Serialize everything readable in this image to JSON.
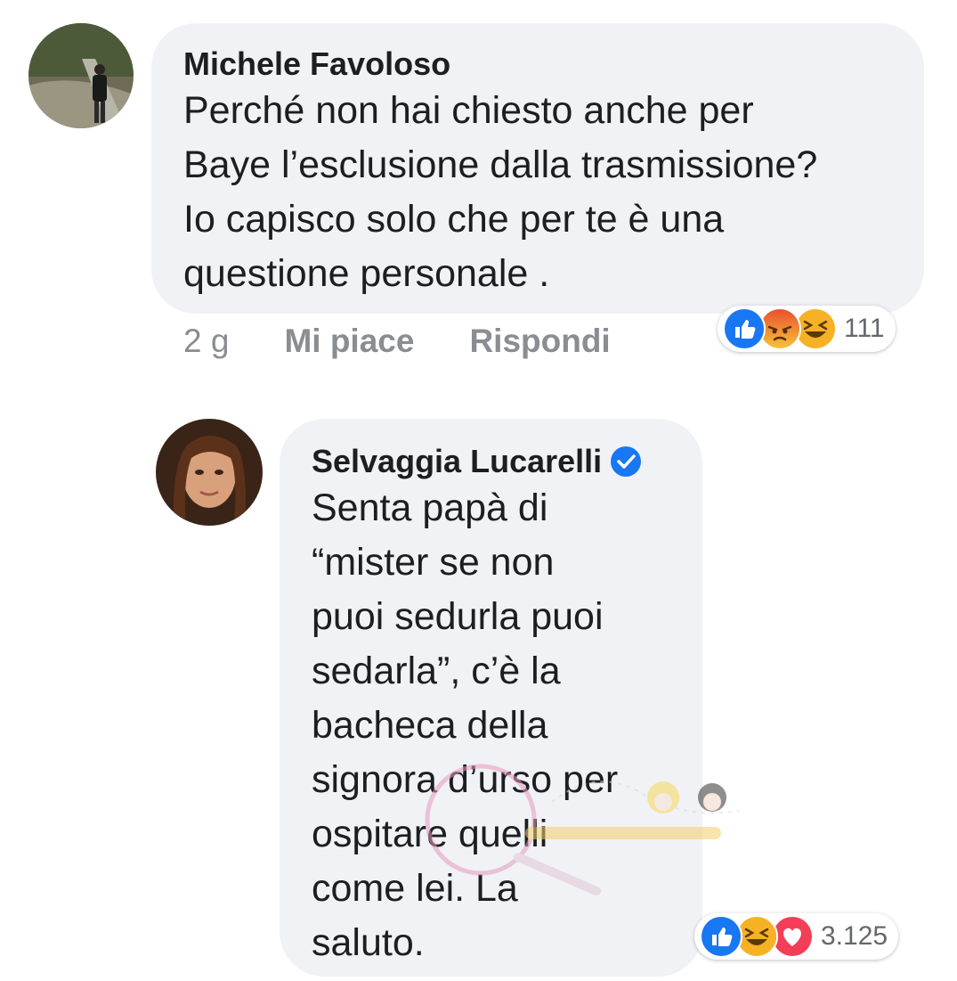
{
  "comment1": {
    "author": "Michele Favoloso",
    "lines": [
      "Perché non hai chiesto anche per",
      "Baye l’esclusione dalla trasmissione?",
      "Io capisco solo che per te è una",
      "questione personale ."
    ],
    "time": "2 g",
    "like_label": "Mi piace",
    "reply_label": "Rispondi",
    "reactions": [
      "like-icon",
      "angry-icon",
      "haha-icon"
    ],
    "reaction_count": "111"
  },
  "comment2": {
    "author": "Selvaggia Lucarelli",
    "verified": true,
    "lines": [
      "Senta papà di",
      "“mister se non",
      "puoi sedurla puoi",
      "sedarla”, c’è la",
      "bacheca della",
      "signora d’urso per",
      "ospitare quelli",
      "come lei. La",
      "saluto."
    ],
    "reactions": [
      "like-icon",
      "haha-icon",
      "love-icon"
    ],
    "reaction_count": "3.125"
  },
  "colors": {
    "bubble": "#f0f2f5",
    "text": "#1c1e21",
    "meta": "#8a8d91",
    "like": "#1877f2",
    "love": "#f33e58",
    "haha": "#f7b125",
    "angry": "#e9710f",
    "verified": "#1877f2"
  }
}
